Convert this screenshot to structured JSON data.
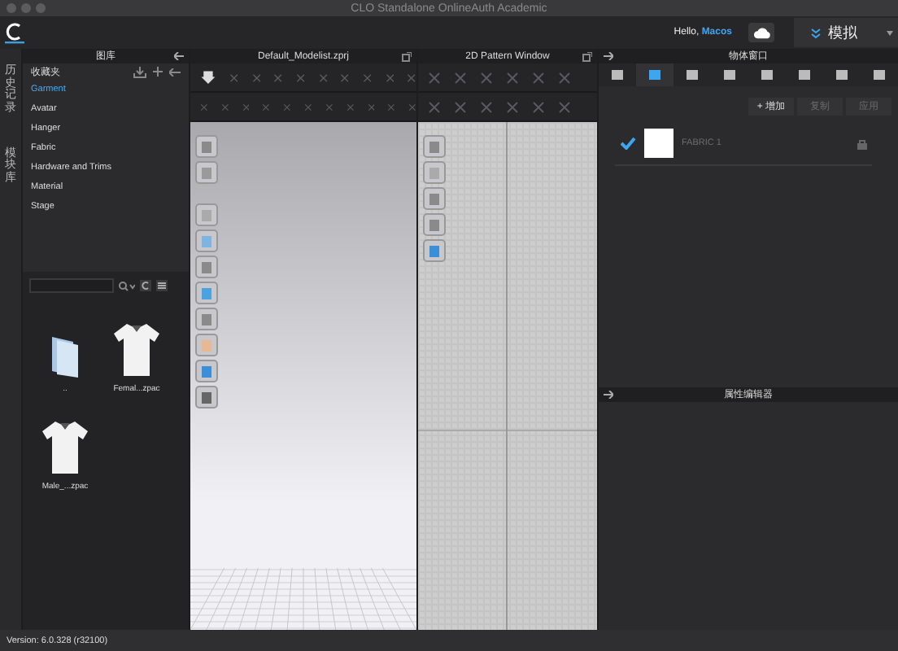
{
  "window": {
    "title": "CLO Standalone OnlineAuth Academic"
  },
  "top_bar": {
    "greeting": "Hello,",
    "user": "Macos",
    "mode": "模拟"
  },
  "side_tabs": [
    {
      "label": "历史记录"
    },
    {
      "label": "模块库"
    }
  ],
  "library": {
    "title": "图库",
    "favorites": "收藏夹",
    "items": [
      {
        "label": "Garment",
        "selected": true
      },
      {
        "label": "Avatar",
        "selected": false
      },
      {
        "label": "Hanger",
        "selected": false
      },
      {
        "label": "Fabric",
        "selected": false
      },
      {
        "label": "Hardware and Trims",
        "selected": false
      },
      {
        "label": "Material",
        "selected": false
      },
      {
        "label": "Stage",
        "selected": false
      }
    ],
    "files": [
      {
        "name": "..",
        "kind": "folder"
      },
      {
        "name": "Femal...zpac",
        "kind": "garment"
      },
      {
        "name": "Male_...zpac",
        "kind": "garment"
      }
    ]
  },
  "viewport_3d": {
    "title": "Default_Modelist.zprj"
  },
  "pattern_2d": {
    "title": "2D Pattern Window"
  },
  "object_browser": {
    "title": "物体窗口",
    "tabs": [
      {
        "selected": false
      },
      {
        "selected": true
      },
      {
        "selected": false
      },
      {
        "selected": false
      },
      {
        "selected": false
      },
      {
        "selected": false
      },
      {
        "selected": false
      },
      {
        "selected": false
      }
    ],
    "actions": [
      {
        "label": "+ 增加",
        "disabled": false
      },
      {
        "label": "复制",
        "disabled": true
      },
      {
        "label": "应用",
        "disabled": true
      }
    ],
    "fabrics": [
      {
        "name": "FABRIC 1",
        "checked": true
      }
    ]
  },
  "property_editor": {
    "title": "属性编辑器"
  },
  "status_bar": {
    "version": "Version: 6.0.328 (r32100)"
  }
}
